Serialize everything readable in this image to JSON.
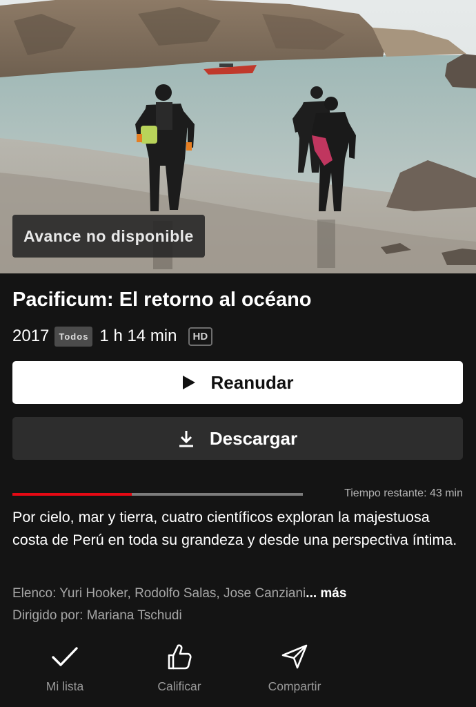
{
  "hero": {
    "preview_badge": "Avance no disponible"
  },
  "title": "Pacificum: El retorno al océano",
  "meta": {
    "year": "2017",
    "rating": "Todos",
    "duration": "1 h 14 min",
    "quality": "HD"
  },
  "buttons": {
    "play": {
      "label": "Reanudar",
      "icon": "play-icon"
    },
    "download": {
      "label": "Descargar",
      "icon": "download-icon"
    }
  },
  "progress": {
    "watched_fraction": 0.41,
    "remaining_text": "Tiempo restante: 43 min",
    "fill_color": "#e50914"
  },
  "synopsis": "Por cielo, mar y tierra, cuatro científicos exploran la majestuosa costa de Perú en toda su grandeza y desde una perspectiva íntima.",
  "credits": {
    "cast": "Elenco: Yuri Hooker, Rodolfo Salas, Jose Canziani",
    "more": "... más",
    "director": "Dirigido por: Mariana Tschudi"
  },
  "actions": [
    {
      "label": "Mi lista",
      "icon": "check-icon"
    },
    {
      "label": "Calificar",
      "icon": "thumbs-up-icon"
    },
    {
      "label": "Compartir",
      "icon": "send-icon"
    }
  ],
  "colors": {
    "background": "#141414",
    "accent": "#e50914"
  }
}
